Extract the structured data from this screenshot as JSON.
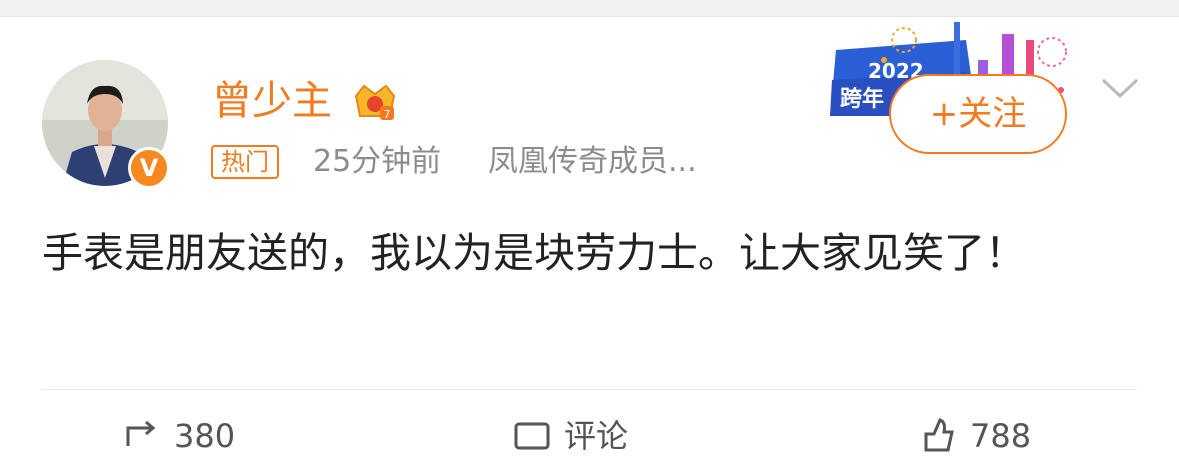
{
  "post": {
    "username": "曾少主",
    "hot_tag": "热门",
    "time": "25分钟前",
    "source": "凤凰传奇成员...",
    "verified_label": "V",
    "follow_button": "+关注",
    "body": "手表是朋友送的，我以为是块劳力士。让大家见笑了！",
    "banner_text": "2022 跨年"
  },
  "actions": {
    "repost_count": "380",
    "comment_label": "评论",
    "like_count": "788"
  },
  "colors": {
    "accent": "#f47a1f",
    "meta_text": "#8c8c8c",
    "body_text": "#222222"
  },
  "icons": [
    "verified-v-icon",
    "crown-badge-icon",
    "chevron-down-icon",
    "repost-icon",
    "comment-icon",
    "like-icon"
  ]
}
